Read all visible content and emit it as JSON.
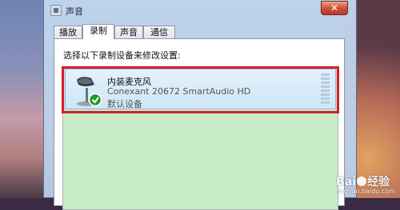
{
  "window": {
    "title": "声音",
    "close_label": "✕"
  },
  "tabs": [
    {
      "label": "播放",
      "active": false
    },
    {
      "label": "录制",
      "active": true
    },
    {
      "label": "声音",
      "active": false
    },
    {
      "label": "通信",
      "active": false
    }
  ],
  "recording": {
    "instruction": "选择以下录制设备来修改设置:",
    "devices": [
      {
        "name": "内装麦克风",
        "description": "Conexant 20672 SmartAudio HD",
        "status": "默认设备",
        "icon": "microphone-icon",
        "default_badge": "check-icon"
      }
    ]
  },
  "watermark": {
    "text_pre": "Bai",
    "text_post": "经验",
    "sub": "jingyan.baidu.com"
  },
  "colors": {
    "highlight": "#d21f27",
    "list_background": "#c8ecc8",
    "selected_row": "#cfe6f7"
  }
}
